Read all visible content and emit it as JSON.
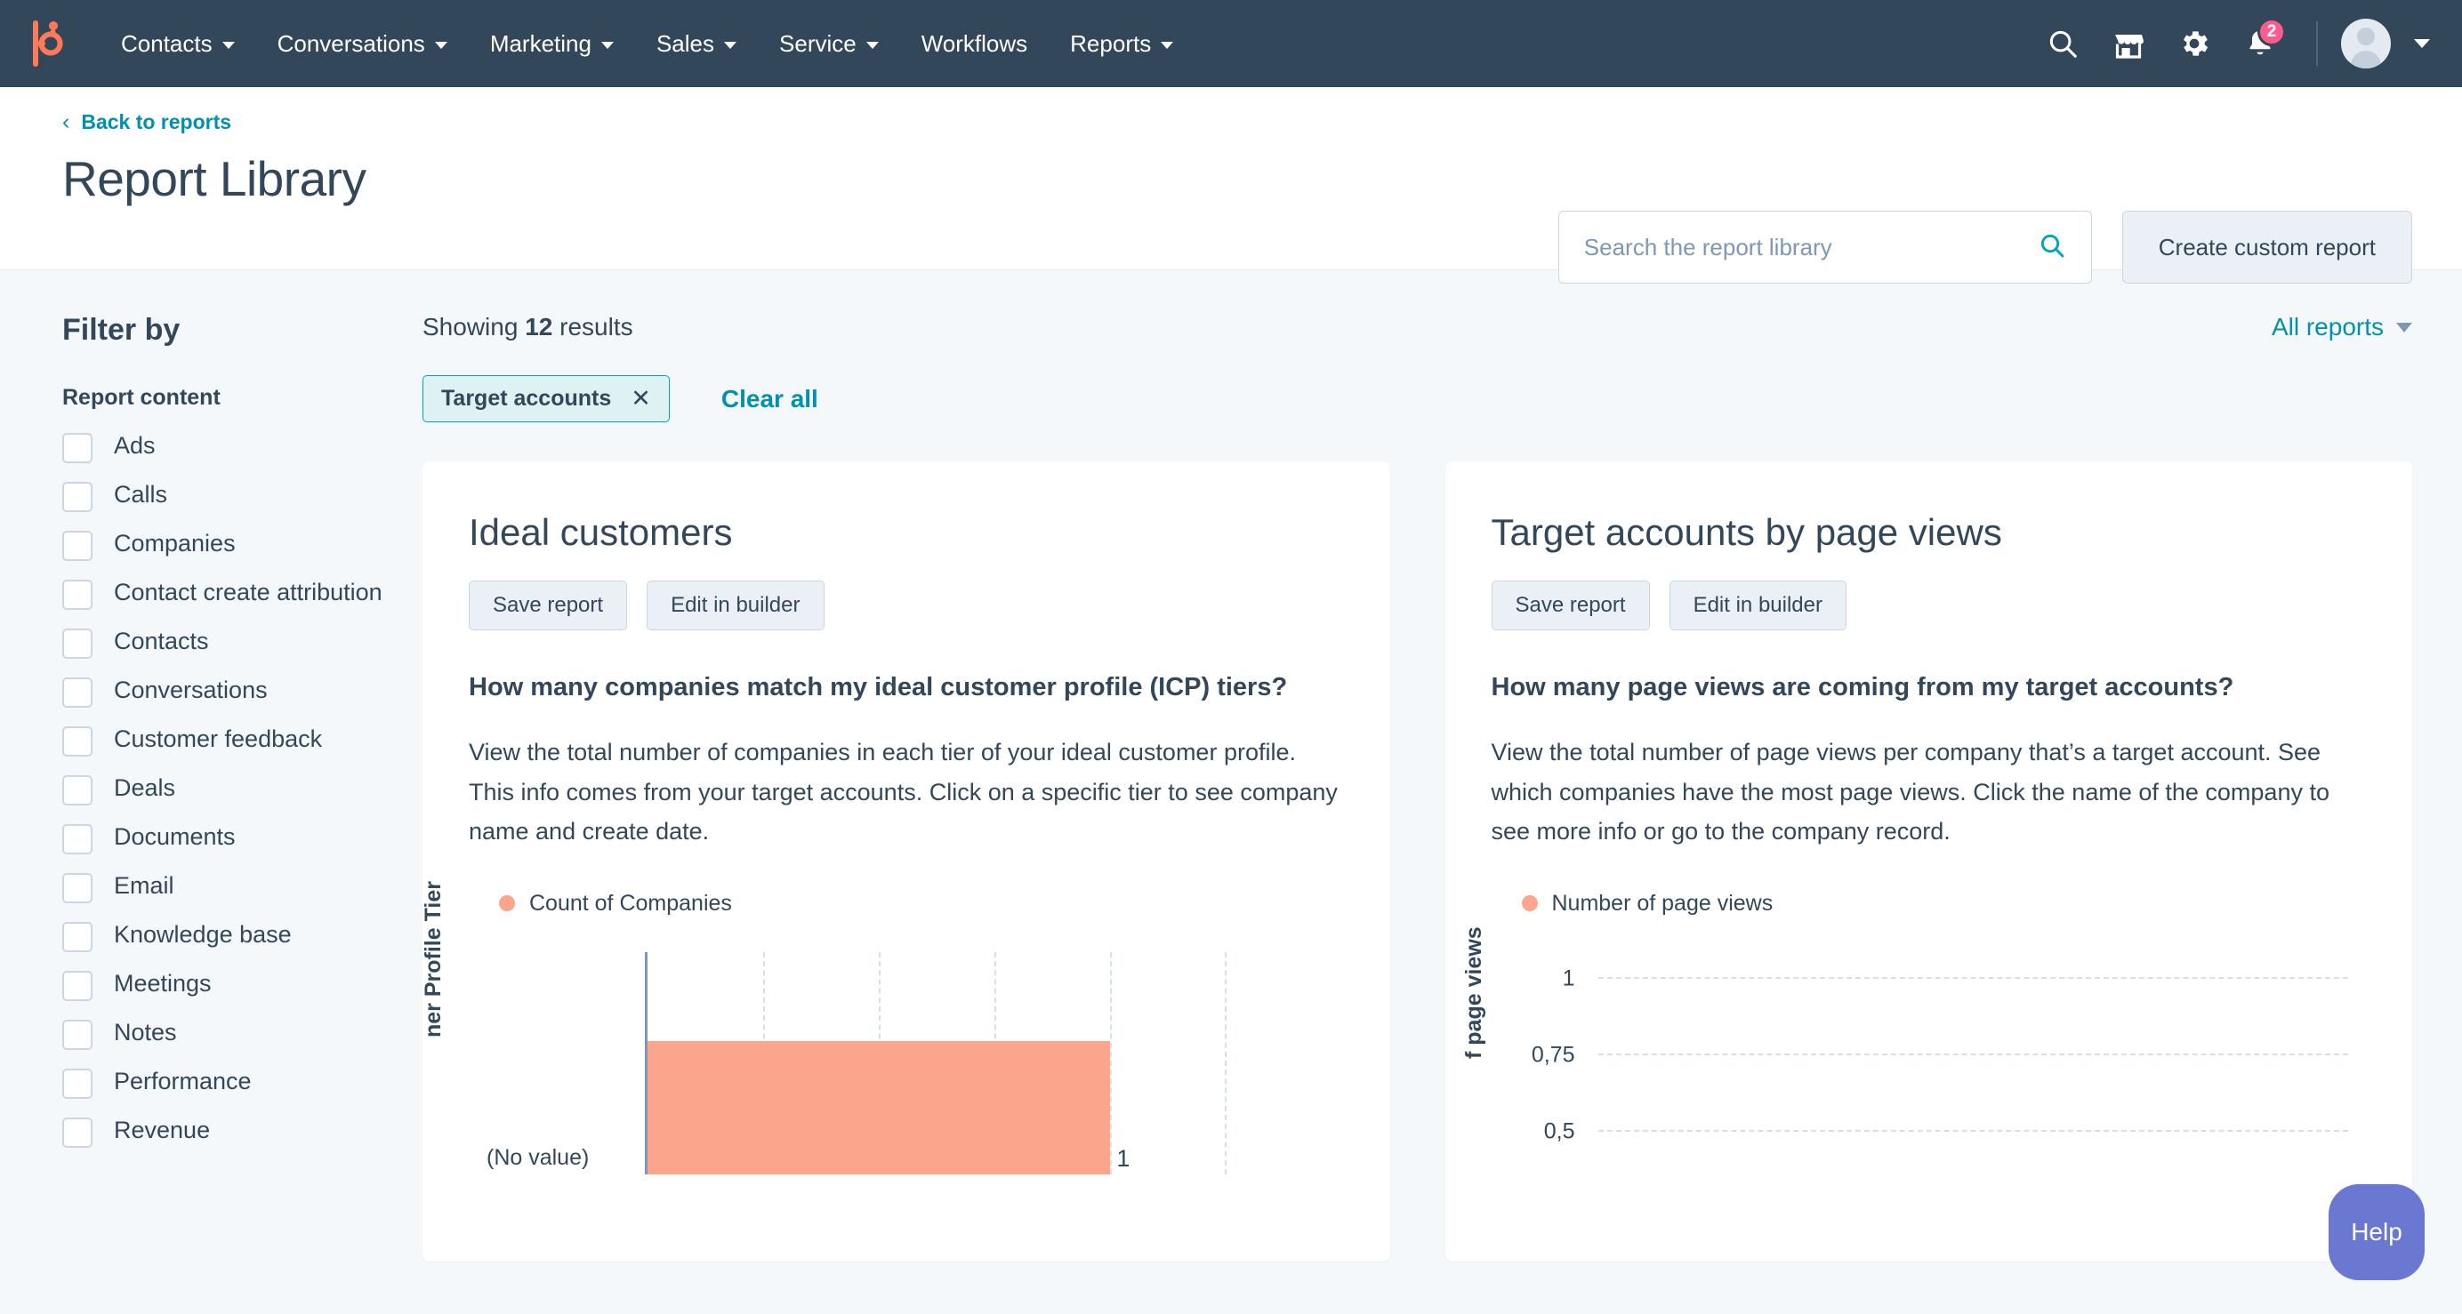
{
  "navbar": {
    "logo_name": "hubspot-sprocket-logo",
    "links": [
      {
        "label": "Contacts",
        "has_caret": true
      },
      {
        "label": "Conversations",
        "has_caret": true
      },
      {
        "label": "Marketing",
        "has_caret": true
      },
      {
        "label": "Sales",
        "has_caret": true
      },
      {
        "label": "Service",
        "has_caret": true
      },
      {
        "label": "Workflows",
        "has_caret": false
      },
      {
        "label": "Reports",
        "has_caret": true
      }
    ],
    "icons": [
      "search-icon",
      "marketplace-icon",
      "settings-gear-icon",
      "notifications-bell-icon"
    ],
    "notification_count": "2",
    "background": "#33475B",
    "accent": "#FF7A59"
  },
  "header": {
    "back_link": "Back to reports",
    "back_chevron": "‹",
    "title": "Report Library",
    "search_placeholder": "Search the report library",
    "search_value": "",
    "create_button": "Create custom report"
  },
  "sidebar": {
    "title": "Filter by",
    "group_title": "Report content",
    "items": [
      {
        "label": "Ads",
        "checked": false
      },
      {
        "label": "Calls",
        "checked": false
      },
      {
        "label": "Companies",
        "checked": false
      },
      {
        "label": "Contact create attribution",
        "checked": false
      },
      {
        "label": "Contacts",
        "checked": false
      },
      {
        "label": "Conversations",
        "checked": false
      },
      {
        "label": "Customer feedback",
        "checked": false
      },
      {
        "label": "Deals",
        "checked": false
      },
      {
        "label": "Documents",
        "checked": false
      },
      {
        "label": "Email",
        "checked": false
      },
      {
        "label": "Knowledge base",
        "checked": false
      },
      {
        "label": "Meetings",
        "checked": false
      },
      {
        "label": "Notes",
        "checked": false
      },
      {
        "label": "Performance",
        "checked": false
      },
      {
        "label": "Revenue",
        "checked": false
      }
    ]
  },
  "main": {
    "showing_prefix": "Showing ",
    "results_count": "12",
    "showing_suffix": " results",
    "active_filter_chip": "Target accounts",
    "chip_remove": "✕",
    "clear_all": "Clear all",
    "view_selector": "All reports"
  },
  "cards": [
    {
      "title": "Ideal customers",
      "save_label": "Save report",
      "edit_label": "Edit in builder",
      "question": "How many companies match my ideal customer profile (ICP) tiers?",
      "description": "View the total number of companies in each tier of your ideal customer profile. This info comes from your target accounts. Click on a specific tier to see company name and create date."
    },
    {
      "title": "Target accounts by page views",
      "save_label": "Save report",
      "edit_label": "Edit in builder",
      "question": "How many page views are coming from my target accounts?",
      "description": "View the total number of page views per company that’s a target account. See which companies have the most page views. Click the name of the company to see more info or go to the company record."
    }
  ],
  "chart_data": [
    {
      "type": "bar",
      "orientation": "horizontal",
      "title": "Ideal customers",
      "legend": [
        "Count of Companies"
      ],
      "legend_position": "top-left",
      "series": [
        {
          "name": "Count of Companies",
          "values": [
            1
          ]
        }
      ],
      "categories": [
        "(No value)"
      ],
      "value_labels": [
        "1"
      ],
      "xlabel": "",
      "ylabel": "Ideal Customer Profile Tier",
      "ylabel_visible": "ner Profile Tier",
      "xlim": [
        0,
        1.25
      ],
      "gridlines": [
        "0.25",
        "0.5",
        "0.75",
        "1",
        "1.25"
      ],
      "grid": true,
      "color": "#FAA58C"
    },
    {
      "type": "bar",
      "orientation": "vertical",
      "title": "Target accounts by page views",
      "legend": [
        "Number of page views"
      ],
      "legend_position": "top-left",
      "series": [
        {
          "name": "Number of page views",
          "values": []
        }
      ],
      "categories": [],
      "xlabel": "",
      "ylabel": "Number of page views",
      "ylabel_visible": "f page views",
      "ytick_labels": [
        "1",
        "0,75",
        "0,5"
      ],
      "ylim": [
        0,
        1
      ],
      "grid": true,
      "color": "#FAA58C"
    }
  ],
  "help": {
    "label": "Help",
    "color": "#6A78D1"
  }
}
